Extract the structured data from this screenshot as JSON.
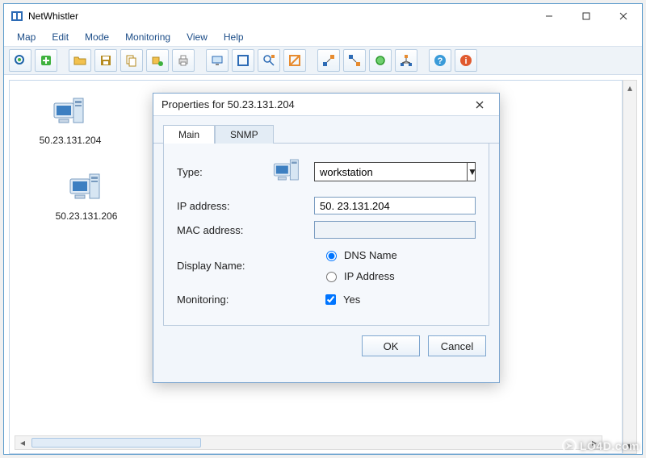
{
  "app": {
    "title": "NetWhistler"
  },
  "menu": {
    "items": [
      "Map",
      "Edit",
      "Mode",
      "Monitoring",
      "View",
      "Help"
    ]
  },
  "toolbar": {
    "buttons": [
      "discover",
      "add",
      "open",
      "save",
      "copy",
      "rename",
      "print",
      "screen",
      "frame",
      "find",
      "highlight",
      "link1",
      "link2",
      "circle",
      "topology",
      "help",
      "info"
    ]
  },
  "nodes": [
    {
      "label": "50.23.131.204"
    },
    {
      "label": "50.23.131.206"
    }
  ],
  "dialog": {
    "title": "Properties for 50.23.131.204",
    "tabs": {
      "main": "Main",
      "snmp": "SNMP"
    },
    "labels": {
      "type": "Type:",
      "ip": "IP address:",
      "mac": "MAC address:",
      "display": "Display Name:",
      "monitoring": "Monitoring:"
    },
    "type_value": "workstation",
    "ip_value": "50. 23.131.204",
    "mac_value": "",
    "radio_dns": "DNS Name",
    "radio_ip": "IP Address",
    "monitoring_label": "Yes",
    "buttons": {
      "ok": "OK",
      "cancel": "Cancel"
    }
  },
  "watermark": "LO4D.com"
}
